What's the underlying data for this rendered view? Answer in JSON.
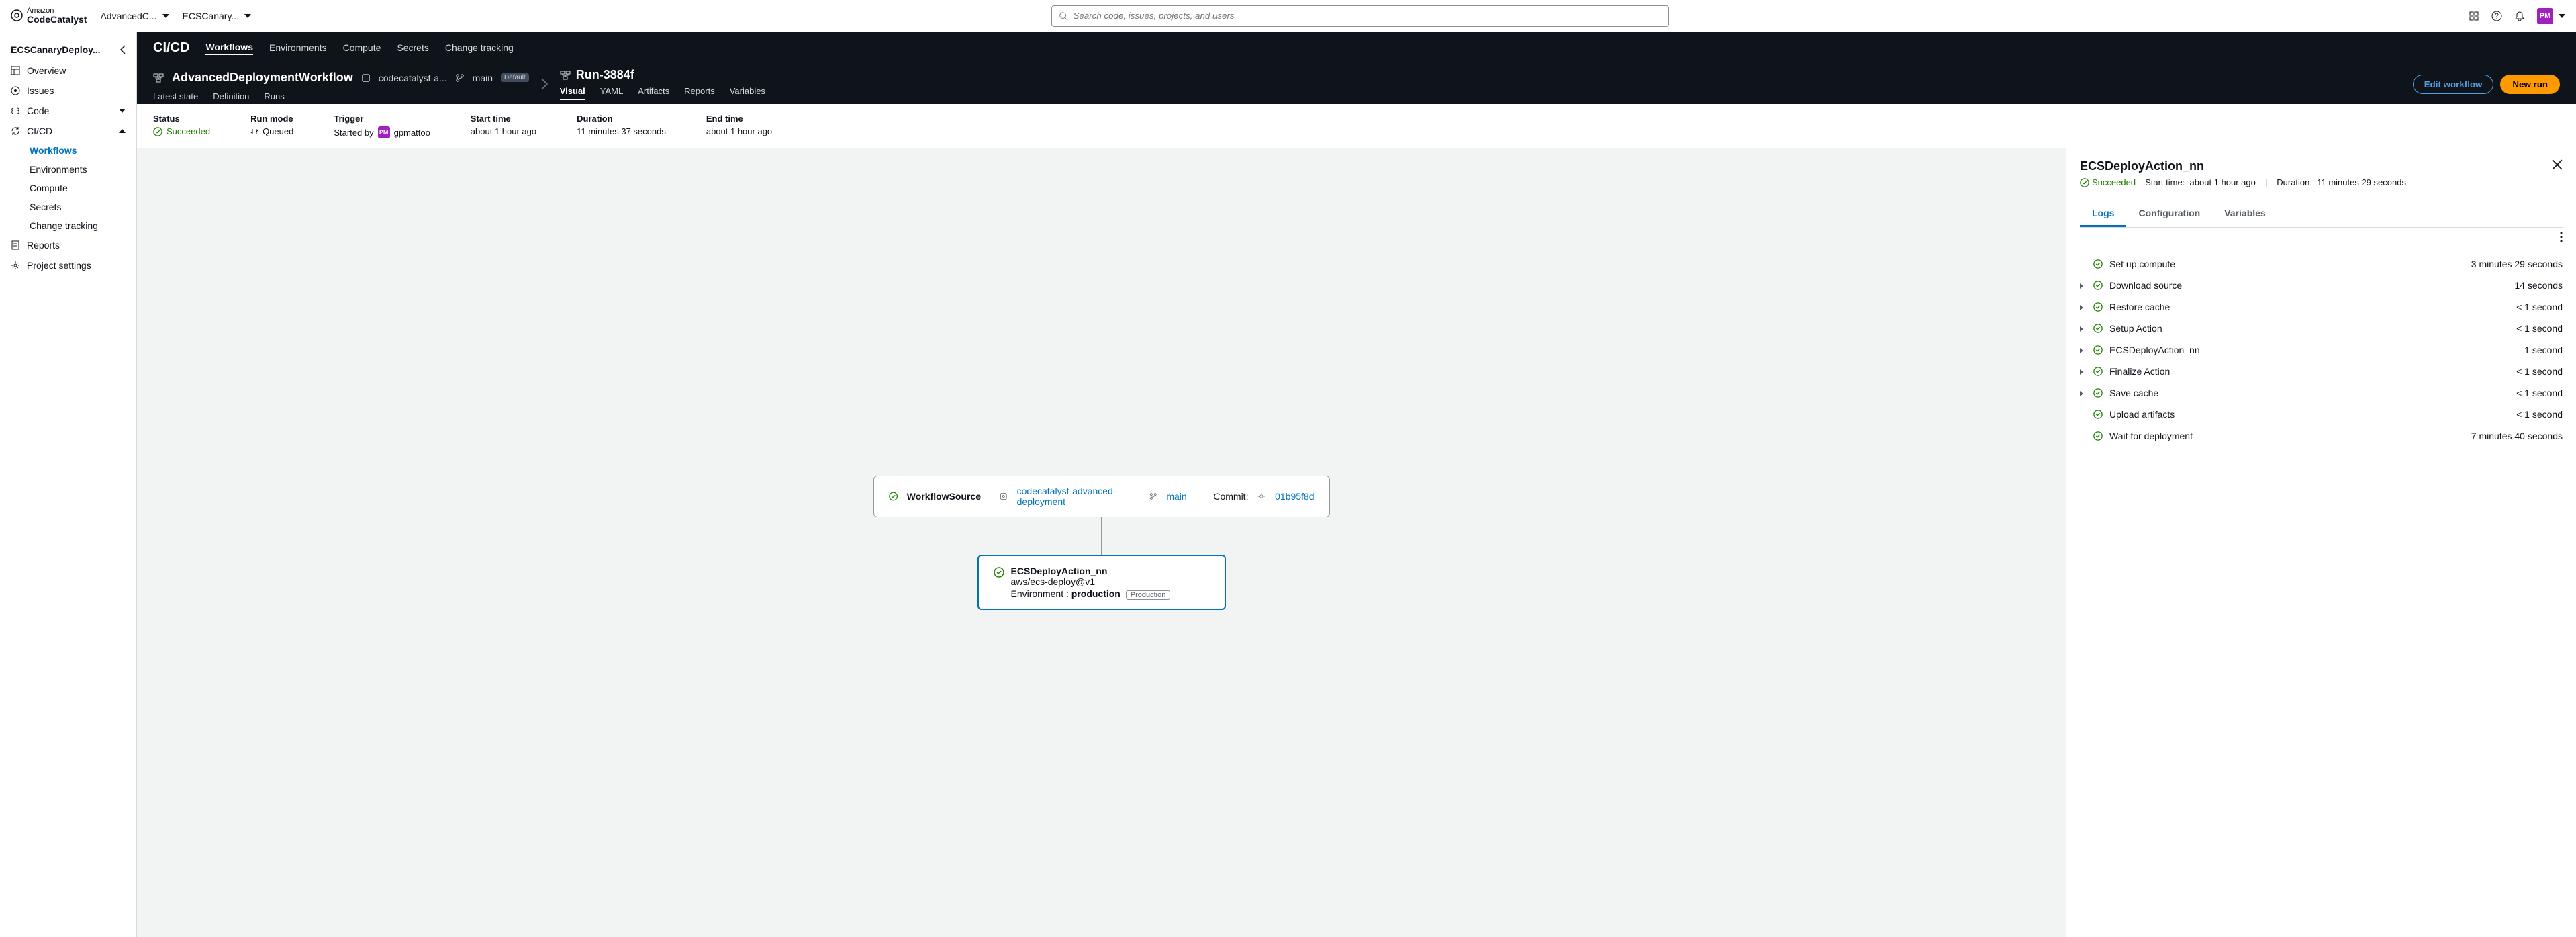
{
  "header": {
    "brand_top": "Amazon",
    "brand_bottom": "CodeCatalyst",
    "breadcrumb": [
      "AdvancedC...",
      "ECSCanary..."
    ],
    "search_placeholder": "Search code, issues, projects, and users",
    "user_initials": "PM"
  },
  "sidebar": {
    "project": "ECSCanaryDeploy...",
    "items": [
      {
        "label": "Overview"
      },
      {
        "label": "Issues"
      },
      {
        "label": "Code"
      },
      {
        "label": "CI/CD",
        "expanded": true,
        "children": [
          {
            "label": "Workflows",
            "active": true
          },
          {
            "label": "Environments"
          },
          {
            "label": "Compute"
          },
          {
            "label": "Secrets"
          },
          {
            "label": "Change tracking"
          }
        ]
      },
      {
        "label": "Reports"
      },
      {
        "label": "Project settings"
      }
    ]
  },
  "cicd_nav": {
    "title": "CI/CD",
    "tabs": [
      "Workflows",
      "Environments",
      "Compute",
      "Secrets",
      "Change tracking"
    ],
    "active": "Workflows"
  },
  "workflow": {
    "name": "AdvancedDeploymentWorkflow",
    "repo": "codecatalyst-a...",
    "branch": "main",
    "badge": "Default",
    "subtabs": [
      "Latest state",
      "Definition",
      "Runs"
    ]
  },
  "run": {
    "name": "Run-3884f",
    "tabs": [
      "Visual",
      "YAML",
      "Artifacts",
      "Reports",
      "Variables"
    ],
    "active": "Visual",
    "actions": {
      "edit": "Edit workflow",
      "new": "New run"
    }
  },
  "details": {
    "status_label": "Status",
    "status_value": "Succeeded",
    "runmode_label": "Run mode",
    "runmode_value": "Queued",
    "trigger_label": "Trigger",
    "trigger_prefix": "Started by",
    "trigger_user": "gpmattoo",
    "start_label": "Start time",
    "start_value": "about 1 hour ago",
    "duration_label": "Duration",
    "duration_value": "11 minutes 37 seconds",
    "end_label": "End time",
    "end_value": "about 1 hour ago"
  },
  "graph": {
    "source": {
      "title": "WorkflowSource",
      "repo": "codecatalyst-advanced-deployment",
      "branch": "main",
      "commit_label": "Commit:",
      "commit": "01b95f8d"
    },
    "action": {
      "title": "ECSDeployAction_nn",
      "subtitle": "aws/ecs-deploy@v1",
      "env_label": "Environment :",
      "env_value": "production",
      "env_badge": "Production"
    }
  },
  "panel": {
    "title": "ECSDeployAction_nn",
    "status": "Succeeded",
    "start_label": "Start time:",
    "start_value": "about 1 hour ago",
    "duration_label": "Duration:",
    "duration_value": "11 minutes 29 seconds",
    "tabs": [
      "Logs",
      "Configuration",
      "Variables"
    ],
    "active": "Logs",
    "logs": [
      {
        "exp": false,
        "name": "Set up compute",
        "dur": "3 minutes 29 seconds"
      },
      {
        "exp": true,
        "name": "Download source",
        "dur": "14 seconds"
      },
      {
        "exp": true,
        "name": "Restore cache",
        "dur": "< 1 second"
      },
      {
        "exp": true,
        "name": "Setup Action",
        "dur": "< 1 second"
      },
      {
        "exp": true,
        "name": "ECSDeployAction_nn",
        "dur": "1 second"
      },
      {
        "exp": true,
        "name": "Finalize Action",
        "dur": "< 1 second"
      },
      {
        "exp": true,
        "name": "Save cache",
        "dur": "< 1 second"
      },
      {
        "exp": false,
        "name": "Upload artifacts",
        "dur": "< 1 second"
      },
      {
        "exp": false,
        "name": "Wait for deployment",
        "dur": "7 minutes 40 seconds"
      }
    ]
  }
}
